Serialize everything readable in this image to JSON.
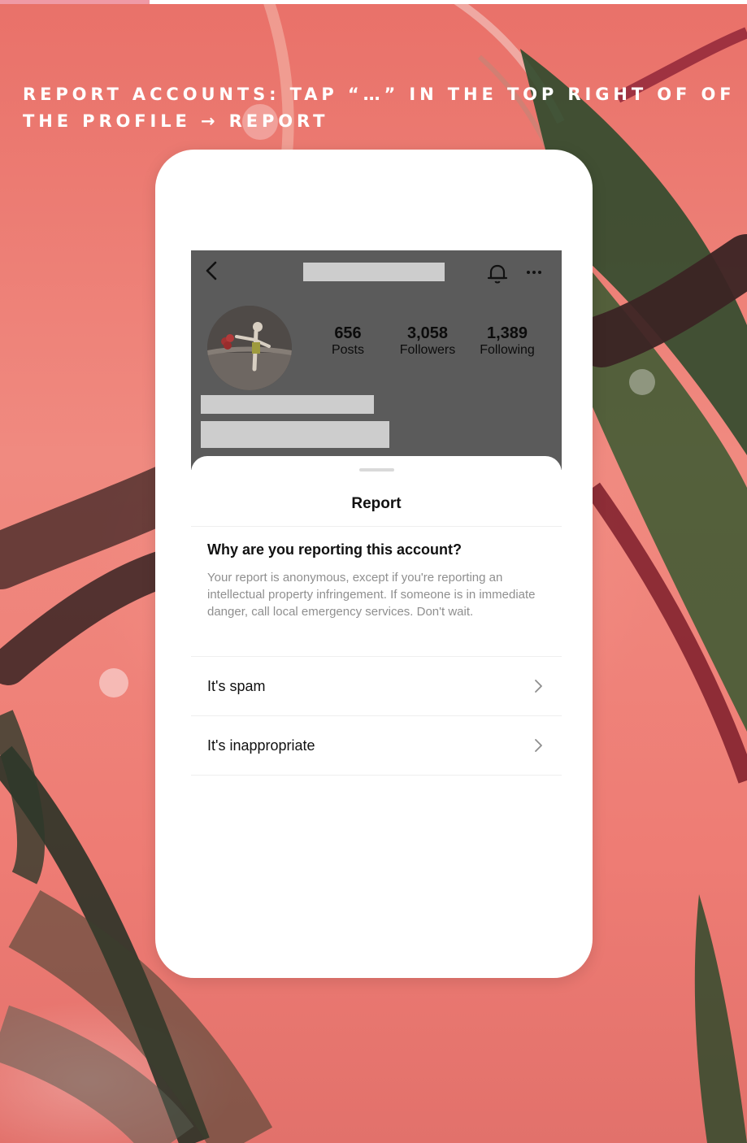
{
  "story": {
    "progress": 0.2,
    "caption": "REPORT ACCOUNTS: TAP “…” IN THE TOP RIGHT OF OF THE PROFILE → REPORT"
  },
  "colors": {
    "background": "#ee7f77",
    "progress_fill": "#ef9aa6",
    "card": "#ffffff",
    "profile_overlay": "#5b5b5b",
    "redaction": "#cdcdcd"
  },
  "profile": {
    "icons": [
      "back-icon",
      "bell-icon",
      "more-icon"
    ],
    "stats": [
      {
        "value": "656",
        "label": "Posts"
      },
      {
        "value": "3,058",
        "label": "Followers"
      },
      {
        "value": "1,389",
        "label": "Following"
      }
    ]
  },
  "sheet": {
    "title": "Report",
    "question": "Why are you reporting this account?",
    "note": "Your report is anonymous, except if you're reporting an intellectual property infringement. If someone is in immediate danger, call local emergency services. Don't wait.",
    "options": [
      {
        "label": "It's spam"
      },
      {
        "label": "It's inappropriate"
      }
    ]
  }
}
